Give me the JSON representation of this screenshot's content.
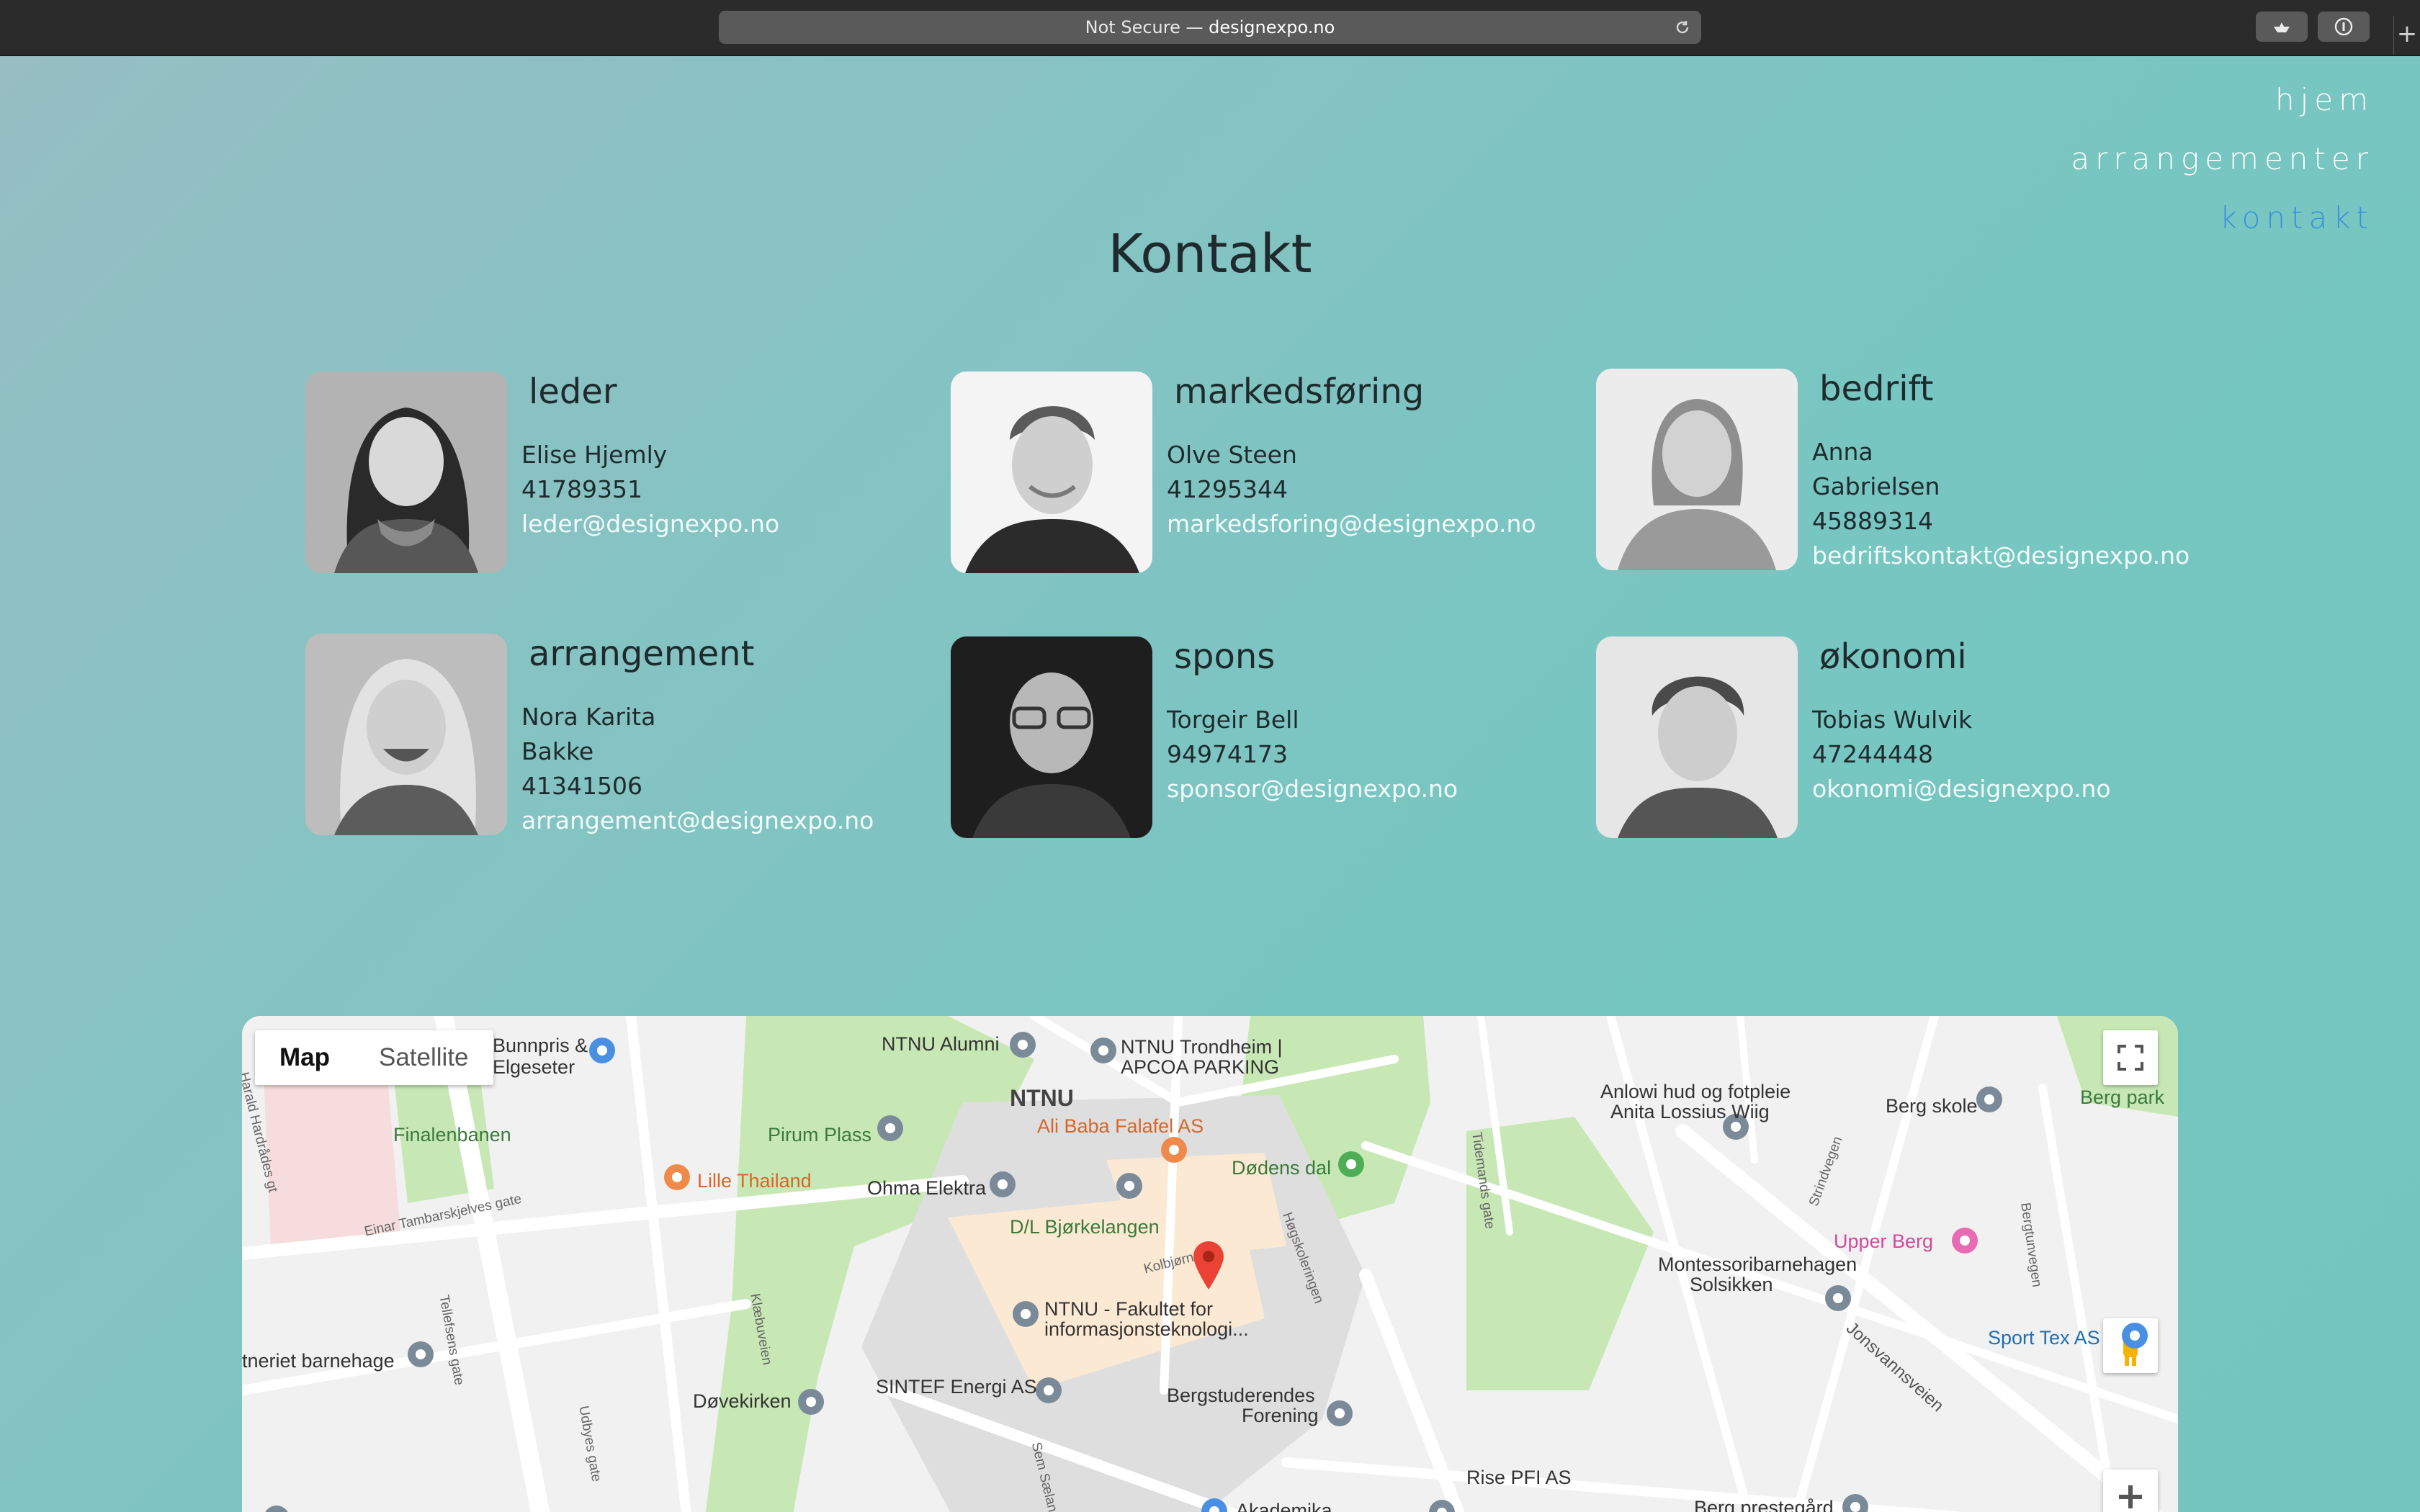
{
  "browser": {
    "url_prefix": "Not Secure — ",
    "url_host": "designexpo.no"
  },
  "nav": {
    "items": [
      "hjem",
      "arrangementer",
      "kontakt"
    ],
    "active": "kontakt",
    "active_color": "#3c8fe0"
  },
  "page": {
    "title": "Kontakt"
  },
  "contacts": [
    {
      "role": "leder",
      "name_lines": [
        "Elise Hjemly"
      ],
      "phone": "41789351",
      "email": "leder@designexpo.no"
    },
    {
      "role": "markedsføring",
      "name_lines": [
        "Olve Steen"
      ],
      "phone": "41295344",
      "email": "markedsforing@designexpo.no"
    },
    {
      "role": "bedrift",
      "name_lines": [
        "Anna",
        "Gabrielsen"
      ],
      "phone": "45889314",
      "email": "bedriftskontakt@designexpo.no"
    },
    {
      "role": "arrangement",
      "name_lines": [
        "Nora Karita",
        "Bakke"
      ],
      "phone": "41341506",
      "email": "arrangement@designexpo.no"
    },
    {
      "role": "spons",
      "name_lines": [
        "Torgeir Bell"
      ],
      "phone": "94974173",
      "email": "sponsor@designexpo.no"
    },
    {
      "role": "økonomi",
      "name_lines": [
        "Tobias Wulvik"
      ],
      "phone": "47244448",
      "email": "okonomi@designexpo.no"
    }
  ],
  "map": {
    "type_buttons": [
      "Map",
      "Satellite"
    ],
    "selected_type": "Map",
    "labels": {
      "bunnpris": "Bunnpris &",
      "elgeseter": "Elgeseter",
      "ntnu_alumni": "NTNU Alumni",
      "ntnu_trondheim": "NTNU Trondheim |",
      "apcoa": "APCOA PARKING",
      "ntnu": "NTNU",
      "finalenbanen": "Finalenbanen",
      "pirum_plass": "Pirum Plass",
      "ali_baba": "Ali Baba Falafel AS",
      "lille_thailand": "Lille Thailand",
      "ohma": "Ohma Elektra",
      "dodens_dal": "Dødens dal",
      "bjorkelangen": "D/L Bjørkelangen",
      "fakultet1": "NTNU - Fakultet for",
      "fakultet2": "informasjonsteknologi...",
      "montessori1": "Montessoribarnehagen",
      "montessori2": "Solsikken",
      "upper_berg": "Upper Berg",
      "anlowi1": "Anlowi hud og fotpleie",
      "anlowi2": "Anita Lossius Wiig",
      "berg_skole": "Berg skole",
      "berg_park": "Berg park",
      "sintef": "SINTEF Energi AS",
      "dovekirken": "Døvekirken",
      "bergstud1": "Bergstuderendes",
      "bergstud2": "Forening",
      "sport_tex": "Sport Tex AS",
      "rise": "Rise PFI AS",
      "akademika": "Akademika",
      "berg_prestegard": "Berg prestegård",
      "barnehage": "tneriet barnehage",
      "einar": "Einar Tambarskjelves gate",
      "tellefsens": "Tellefsens gate",
      "udbyes": "Udbyes gate",
      "klaebuveien": "Klæbuveien",
      "hogskoleringen": "Høgskoleringen",
      "jonsvannsveien": "Jonsvannsveien",
      "kolbjorn": "Kolbjørn",
      "sem_saelands": "Sem Sælands vei",
      "tidemands": "Tidemands gate",
      "strindvegen": "Strindvegen",
      "bergtunvegen": "Bergtunvegen",
      "harald": "Harald Hardrådes gt"
    }
  }
}
